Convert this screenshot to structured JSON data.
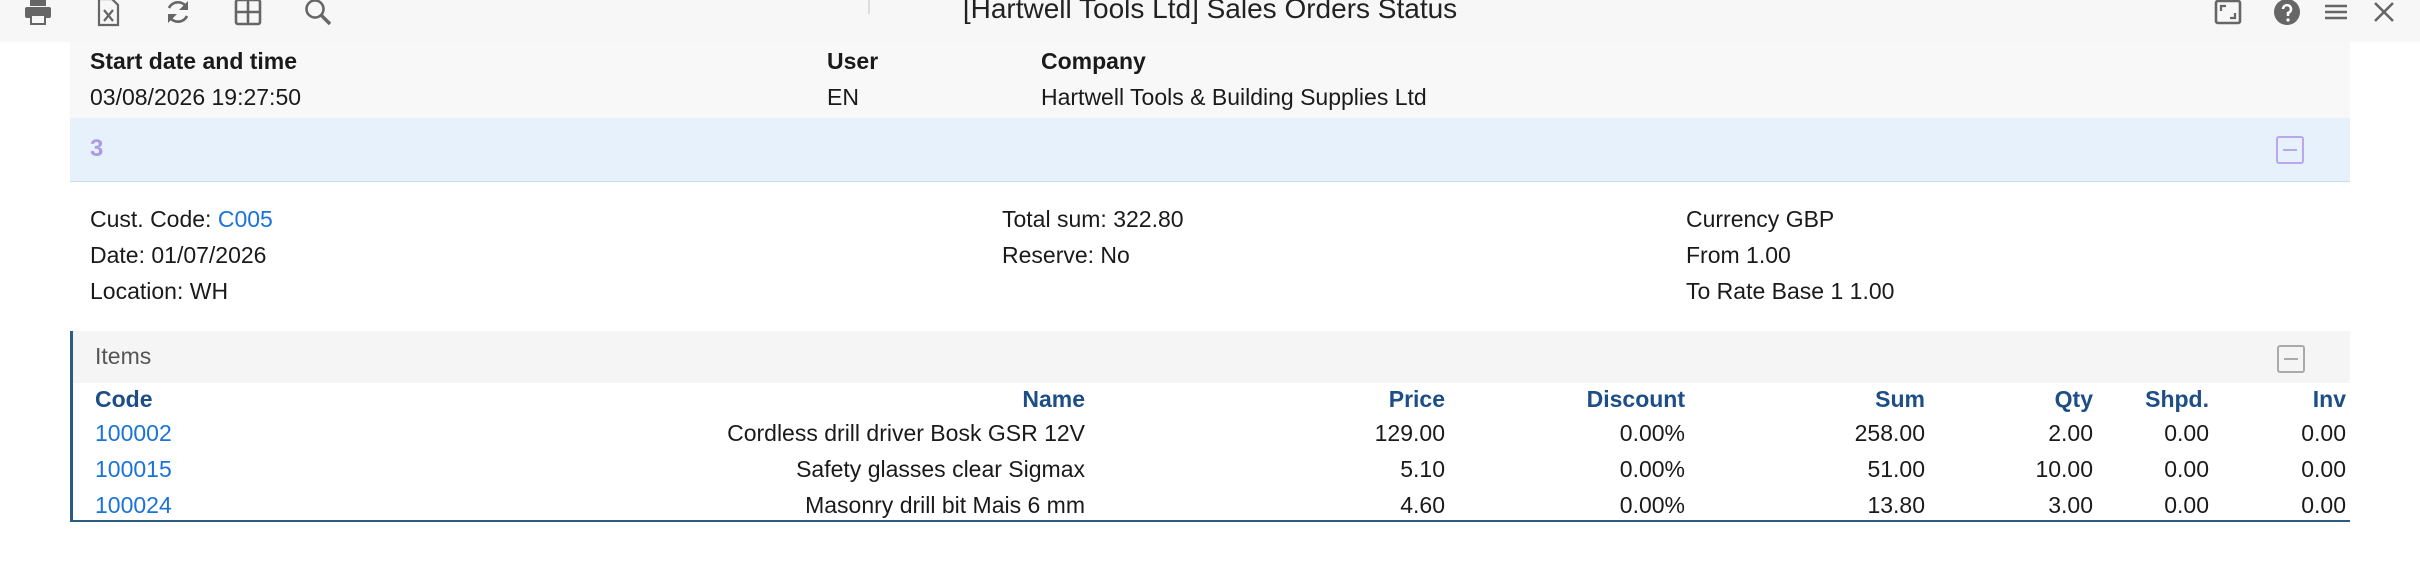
{
  "toolbar": {
    "title": "[Hartwell Tools Ltd] Sales Orders Status",
    "icons_left": [
      "print-icon",
      "excel-export-icon",
      "refresh-icon",
      "grid-icon",
      "search-icon"
    ],
    "icons_right": [
      "expand-icon",
      "help-icon",
      "menu-icon",
      "close-icon"
    ]
  },
  "meta": {
    "start_label": "Start date and time",
    "start_value": "03/08/2026 19:27:50",
    "user_label": "User",
    "user_value": "EN",
    "company_label": "Company",
    "company_value": "Hartwell Tools & Building Supplies Ltd"
  },
  "group": {
    "number": "3"
  },
  "details": {
    "cust_code_label": "Cust. Code: ",
    "cust_code_value": "C005",
    "date": "Date: 01/07/2026",
    "location": "Location: WH",
    "total_sum": "Total sum: 322.80",
    "reserve": "Reserve: No",
    "currency": "Currency GBP",
    "from": "From 1.00",
    "to_rate": "To Rate Base 1 1.00"
  },
  "items": {
    "label": "Items",
    "columns": [
      "Code",
      "Name",
      "Price",
      "Discount",
      "Sum",
      "Qty",
      "Shpd.",
      "Inv"
    ],
    "rows": [
      [
        "100002",
        "Cordless drill driver Bosk GSR 12V",
        "129.00",
        "0.00%",
        "258.00",
        "2.00",
        "0.00",
        "0.00"
      ],
      [
        "100015",
        "Safety glasses clear Sigmax",
        "5.10",
        "0.00%",
        "51.00",
        "10.00",
        "0.00",
        "0.00"
      ],
      [
        "100024",
        "Masonry drill bit Mais 6 mm",
        "4.60",
        "0.00%",
        "13.80",
        "3.00",
        "0.00",
        "0.00"
      ]
    ]
  }
}
